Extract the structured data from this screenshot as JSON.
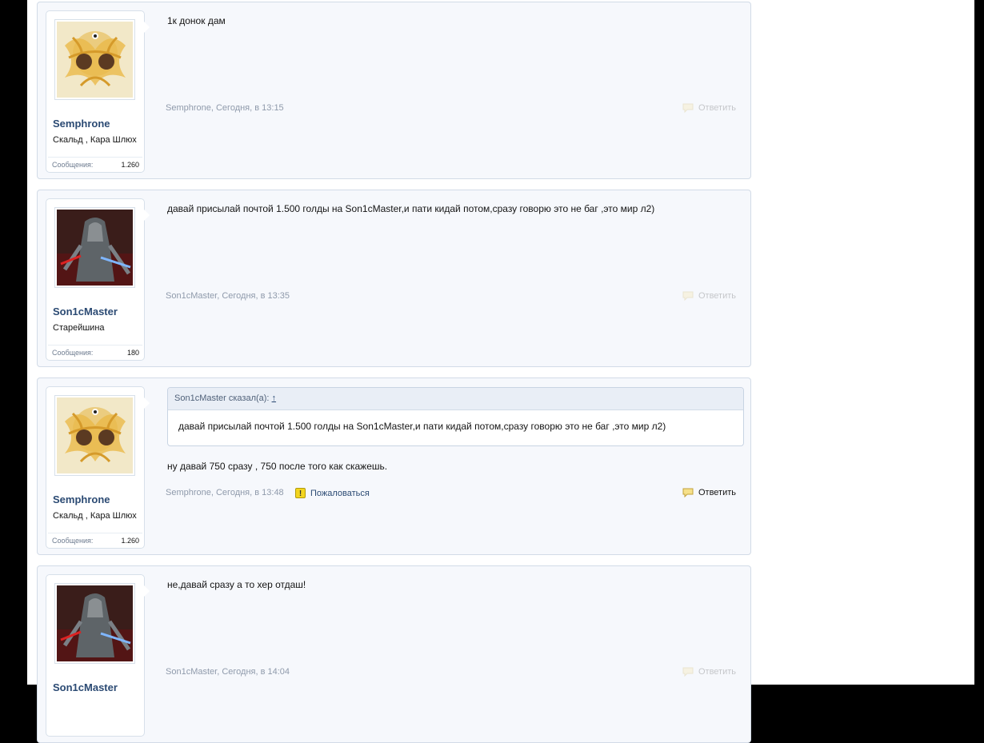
{
  "posts": [
    {
      "author": "Semphrone",
      "user_title": "Скальд , Кара Шлюх",
      "stats_label": "Сообщения:",
      "stats_value": "1.260",
      "message": "1к донок дам",
      "meta": "Semphrone, Сегодня, в 13:15",
      "reply_label": "Ответить"
    },
    {
      "author": "Son1cMaster",
      "user_title": "Старейшина",
      "stats_label": "Сообщения:",
      "stats_value": "180",
      "message": "давай присылай почтой 1.500 голды на Son1cMaster,и пати кидай потом,сразу говорю это не баг ,это мир л2)",
      "meta": "Son1cMaster, Сегодня, в 13:35",
      "reply_label": "Ответить"
    },
    {
      "author": "Semphrone",
      "user_title": "Скальд , Кара Шлюх",
      "stats_label": "Сообщения:",
      "stats_value": "1.260",
      "quote_author": "Son1cMaster сказал(а):",
      "quote_arrow": "↑",
      "quote_text": "давай присылай почтой 1.500 голды на Son1cMaster,и пати кидай потом,сразу говорю это не баг ,это мир л2)",
      "message": "ну давай 750 сразу , 750 после того как скажешь.",
      "meta": "Semphrone, Сегодня, в 13:48",
      "report_label": "Пожаловаться",
      "reply_label": "Ответить"
    },
    {
      "author": "Son1cMaster",
      "message": "не,давай сразу а то хер отдаш!",
      "meta": "Son1cMaster, Сегодня, в 14:04",
      "reply_label": "Ответить"
    }
  ],
  "icons": {
    "reply": "speech-bubble-icon",
    "report": "warning-icon"
  },
  "colors": {
    "username": "#2b4a73",
    "post_bg": "#f6f8fc",
    "border": "#d2dbe7"
  }
}
